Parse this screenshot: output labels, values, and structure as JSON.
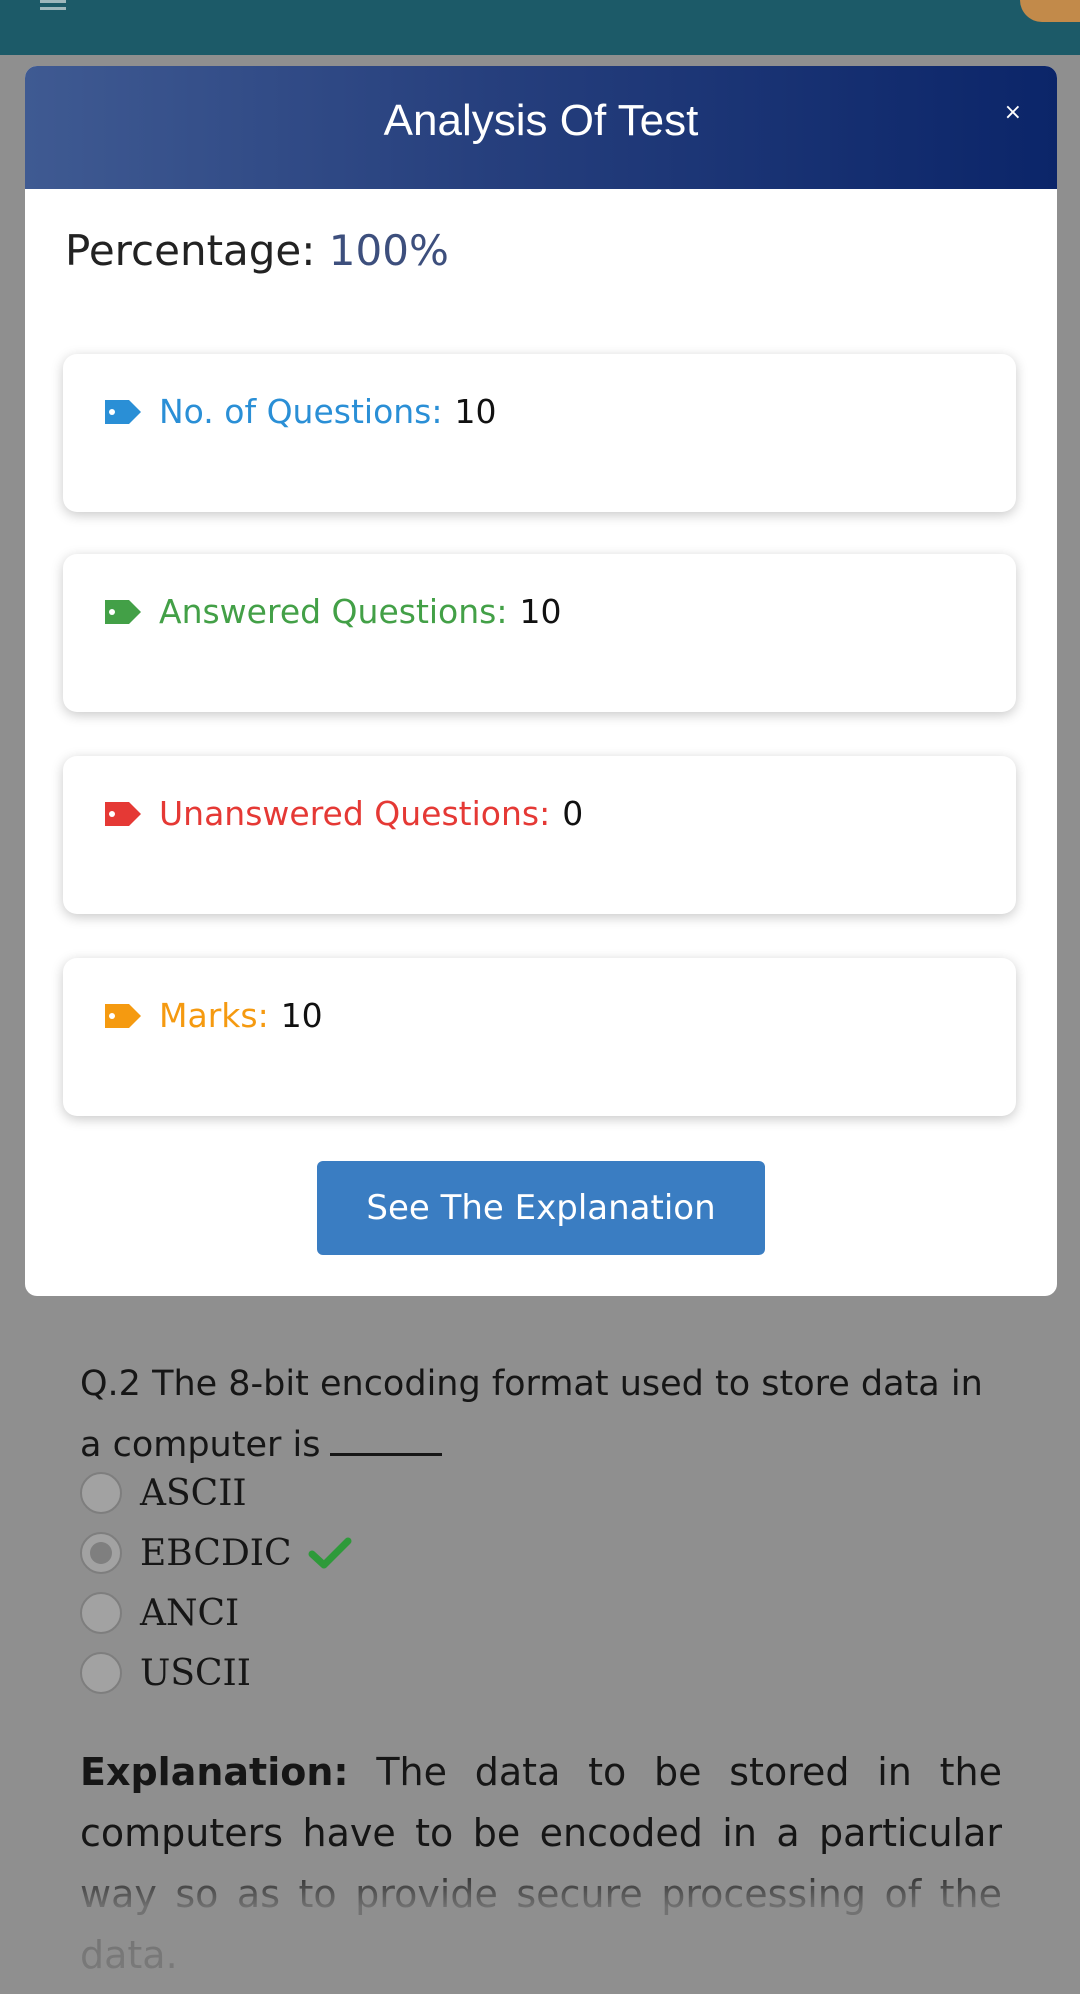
{
  "modal": {
    "title": "Analysis Of Test",
    "close_label": "×",
    "percentage_label": "Percentage:",
    "percentage_value": "100%",
    "stats": [
      {
        "label": "No. of Questions:",
        "value": "10",
        "color": "#2a8fd6"
      },
      {
        "label": "Answered Questions:",
        "value": "10",
        "color": "#43a047"
      },
      {
        "label": "Unanswered Questions:",
        "value": "0",
        "color": "#e53935"
      },
      {
        "label": "Marks:",
        "value": "10",
        "color": "#f59a10"
      }
    ],
    "explanation_button": "See The Explanation"
  },
  "question": {
    "text": "Q.2 The 8-bit encoding format used to store data in a computer is",
    "options": [
      {
        "label": "ASCII",
        "selected": false,
        "correct": false
      },
      {
        "label": "EBCDIC",
        "selected": true,
        "correct": true
      },
      {
        "label": "ANCI",
        "selected": false,
        "correct": false
      },
      {
        "label": "USCII",
        "selected": false,
        "correct": false
      }
    ],
    "explanation_label": "Explanation:",
    "explanation_text": "The data to be stored in the computers have to be encoded in a particular way so as to provide secure processing of the data."
  }
}
